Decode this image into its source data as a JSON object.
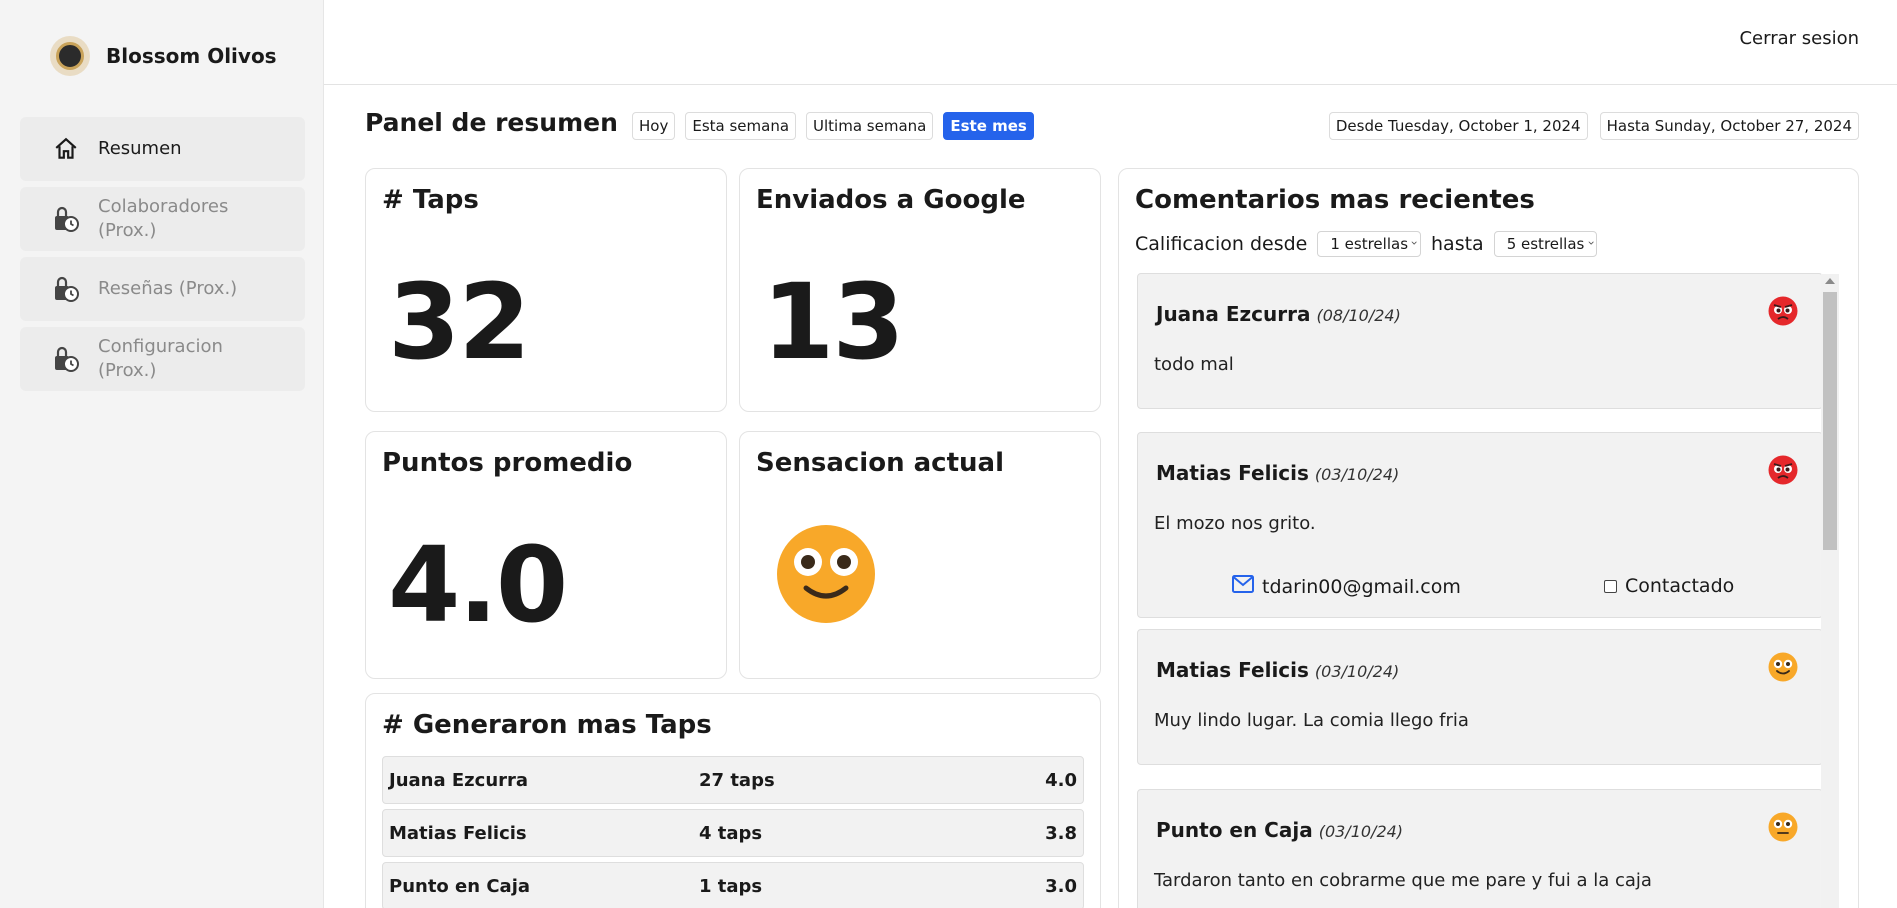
{
  "brand": {
    "name": "Blossom Olivos"
  },
  "sidebar": {
    "items": [
      {
        "label": "Resumen",
        "icon": "home-icon",
        "active": true
      },
      {
        "label": "Colaboradores (Prox.)",
        "icon": "lock-clock-icon",
        "active": false
      },
      {
        "label": "Reseñas (Prox.)",
        "icon": "lock-clock-icon",
        "active": false
      },
      {
        "label": "Configuracion (Prox.)",
        "icon": "lock-clock-icon",
        "active": false
      }
    ]
  },
  "header": {
    "logout_label": "Cerrar sesion"
  },
  "summary": {
    "title": "Panel de resumen",
    "ranges": [
      "Hoy",
      "Esta semana",
      "Ultima semana",
      "Este mes"
    ],
    "active_range": "Este mes",
    "date_from": "Desde Tuesday, October 1, 2024",
    "date_to": "Hasta Sunday, October 27, 2024"
  },
  "cards": {
    "taps": {
      "title": "# Taps",
      "value": "32"
    },
    "google": {
      "title": "Enviados a Google",
      "value": "13"
    },
    "points": {
      "title": "Puntos promedio",
      "value": "4.0"
    },
    "mood": {
      "title": "Sensacion actual",
      "icon": "neutral-smile-face-icon"
    }
  },
  "top_taps": {
    "title": "# Generaron mas Taps",
    "rows": [
      {
        "name": "Juana Ezcurra",
        "taps": "27 taps",
        "score": "4.0"
      },
      {
        "name": "Matias Felicis",
        "taps": "4 taps",
        "score": "3.8"
      },
      {
        "name": "Punto en Caja",
        "taps": "1 taps",
        "score": "3.0"
      }
    ]
  },
  "comments": {
    "title": "Comentarios mas recientes",
    "filter_from_label": "Calificacion desde",
    "filter_from_value": "1 estrellas",
    "filter_to_label": "hasta",
    "filter_to_value": "5 estrellas",
    "items": [
      {
        "author": "Juana Ezcurra",
        "date": "(08/10/24)",
        "text": "todo mal",
        "emoji": "angry-face-icon"
      },
      {
        "author": "Matias Felicis",
        "date": "(03/10/24)",
        "text": "El mozo nos grito.",
        "emoji": "angry-face-icon",
        "email": "tdarin00@gmail.com",
        "contacted_label": "Contactado",
        "contacted": false
      },
      {
        "author": "Matias Felicis",
        "date": "(03/10/24)",
        "text": "Muy lindo lugar. La comia llego fria",
        "emoji": "smile-face-icon"
      },
      {
        "author": "Punto en Caja",
        "date": "(03/10/24)",
        "text": "Tardaron tanto en cobrarme que me pare y fui a la caja",
        "emoji": "neutral-face-icon"
      }
    ]
  },
  "colors": {
    "accent": "#2563eb",
    "angry": "#e5282b",
    "emoji_yellow": "#f8a829"
  }
}
